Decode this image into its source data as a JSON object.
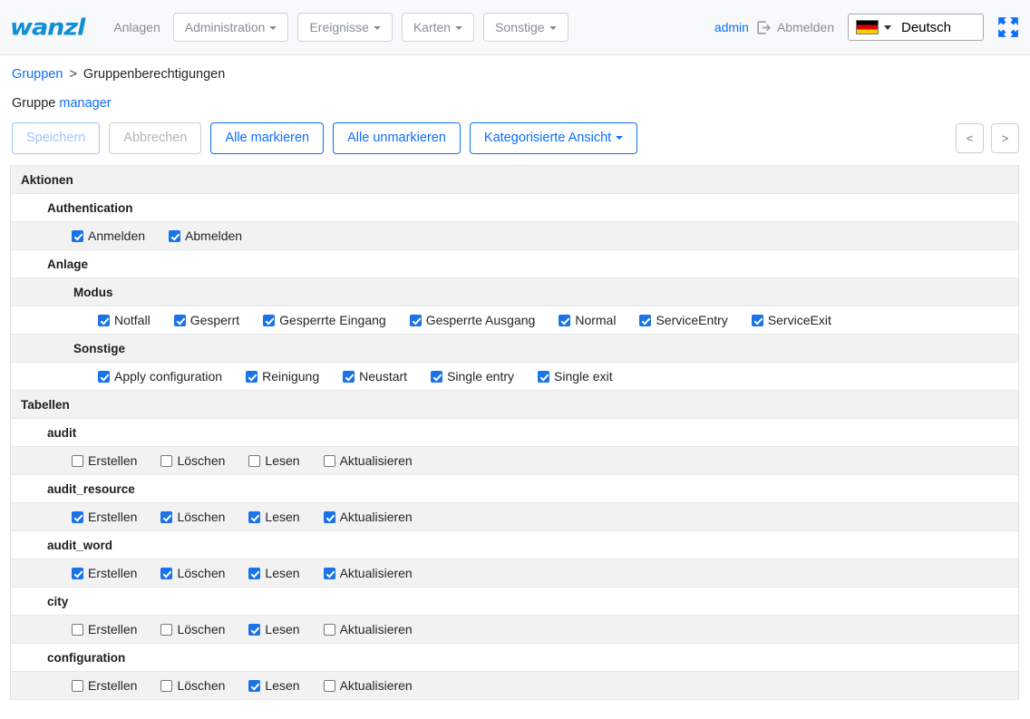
{
  "navbar": {
    "brand": "wanzl",
    "plain_link": "Anlagen",
    "menus": [
      {
        "label": "Administration"
      },
      {
        "label": "Ereignisse"
      },
      {
        "label": "Karten"
      },
      {
        "label": "Sonstige"
      }
    ],
    "user": "admin",
    "logout_label": "Abmelden",
    "logout_icon": "logout-icon",
    "language": "Deutsch",
    "language_flag": "german-flag-icon",
    "fullscreen_icon": "fullscreen-expand-icon",
    "accent_color": "#0d6efd",
    "brand_color": "#0f8fd7"
  },
  "breadcrumb": {
    "root": "Gruppen",
    "separator": ">",
    "current": "Gruppenberechtigungen"
  },
  "group_line": {
    "label": "Gruppe",
    "name": "manager"
  },
  "toolbar": {
    "save_label": "Speichern",
    "cancel_label": "Abbrechen",
    "select_all_label": "Alle markieren",
    "deselect_all_label": "Alle unmarkieren",
    "view_mode_label": "Kategorisierte Ansicht",
    "prev_label": "<",
    "next_label": ">"
  },
  "sections": [
    {
      "title": "Aktionen",
      "groups": [
        {
          "title": "Authentication",
          "items": [
            {
              "label": "Anmelden",
              "checked": true
            },
            {
              "label": "Abmelden",
              "checked": true
            }
          ]
        },
        {
          "title": "Anlage",
          "subgroups": [
            {
              "title": "Modus",
              "items": [
                {
                  "label": "Notfall",
                  "checked": true
                },
                {
                  "label": "Gesperrt",
                  "checked": true
                },
                {
                  "label": "Gesperrte Eingang",
                  "checked": true
                },
                {
                  "label": "Gesperrte Ausgang",
                  "checked": true
                },
                {
                  "label": "Normal",
                  "checked": true
                },
                {
                  "label": "ServiceEntry",
                  "checked": true
                },
                {
                  "label": "ServiceExit",
                  "checked": true
                }
              ]
            },
            {
              "title": "Sonstige",
              "items": [
                {
                  "label": "Apply configuration",
                  "checked": true
                },
                {
                  "label": "Reinigung",
                  "checked": true
                },
                {
                  "label": "Neustart",
                  "checked": true
                },
                {
                  "label": "Single entry",
                  "checked": true
                },
                {
                  "label": "Single exit",
                  "checked": true
                }
              ]
            }
          ]
        }
      ]
    },
    {
      "title": "Tabellen",
      "groups": [
        {
          "title": "audit",
          "items": [
            {
              "label": "Erstellen",
              "checked": false
            },
            {
              "label": "Löschen",
              "checked": false
            },
            {
              "label": "Lesen",
              "checked": false
            },
            {
              "label": "Aktualisieren",
              "checked": false
            }
          ]
        },
        {
          "title": "audit_resource",
          "items": [
            {
              "label": "Erstellen",
              "checked": true
            },
            {
              "label": "Löschen",
              "checked": true
            },
            {
              "label": "Lesen",
              "checked": true
            },
            {
              "label": "Aktualisieren",
              "checked": true
            }
          ]
        },
        {
          "title": "audit_word",
          "items": [
            {
              "label": "Erstellen",
              "checked": true
            },
            {
              "label": "Löschen",
              "checked": true
            },
            {
              "label": "Lesen",
              "checked": true
            },
            {
              "label": "Aktualisieren",
              "checked": true
            }
          ]
        },
        {
          "title": "city",
          "items": [
            {
              "label": "Erstellen",
              "checked": false
            },
            {
              "label": "Löschen",
              "checked": false
            },
            {
              "label": "Lesen",
              "checked": true
            },
            {
              "label": "Aktualisieren",
              "checked": false
            }
          ]
        },
        {
          "title": "configuration",
          "items": [
            {
              "label": "Erstellen",
              "checked": false
            },
            {
              "label": "Löschen",
              "checked": false
            },
            {
              "label": "Lesen",
              "checked": true
            },
            {
              "label": "Aktualisieren",
              "checked": false
            }
          ]
        }
      ]
    }
  ]
}
